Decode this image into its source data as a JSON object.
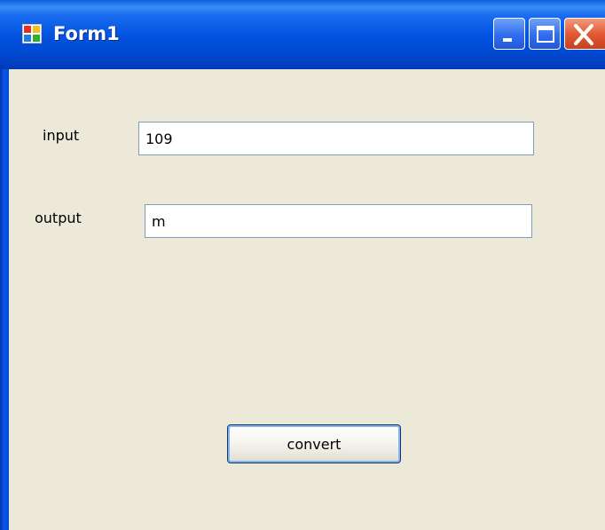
{
  "window": {
    "title": "Form1",
    "controls": {
      "minimize": "minimize",
      "maximize": "maximize",
      "close": "close"
    }
  },
  "form": {
    "input_label": "input",
    "input_value": "109",
    "output_label": "output",
    "output_value": "m",
    "convert_label": "convert"
  },
  "colors": {
    "titlebar": "#0054e3",
    "client_bg": "#ece9d8",
    "textbox_border": "#7f9db9",
    "close_button": "#e25b35"
  },
  "icons": [
    "app-icon",
    "minimize-icon",
    "maximize-icon",
    "close-icon"
  ]
}
